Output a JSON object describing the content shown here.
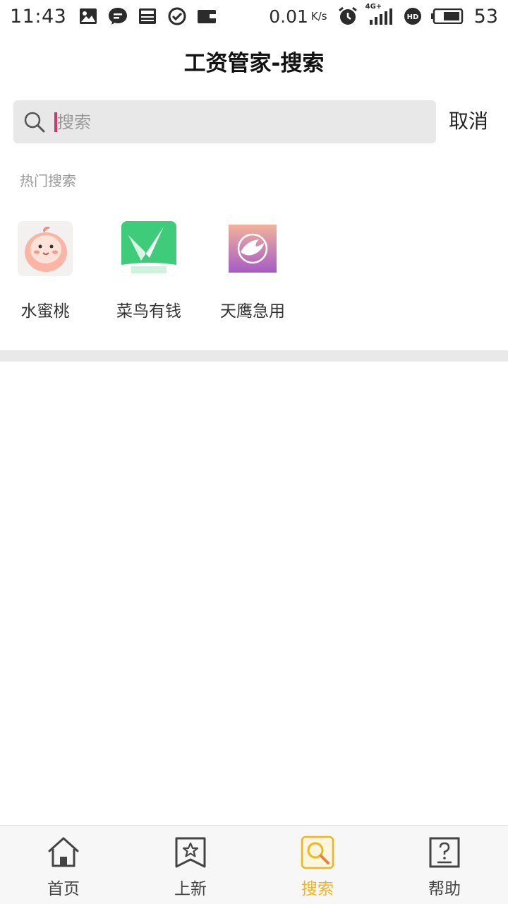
{
  "status_bar": {
    "time": "11:43",
    "net_speed": "0.01",
    "net_unit": "K/s",
    "network": "4G+",
    "battery": "53",
    "icons": [
      "image-icon",
      "chat-icon",
      "news-icon",
      "check-icon",
      "wallet-icon",
      "alarm-icon",
      "signal-icon",
      "hd-icon",
      "battery-icon"
    ]
  },
  "header": {
    "title": "工资管家-搜索"
  },
  "search": {
    "placeholder": "搜索",
    "value": "",
    "cancel_label": "取消"
  },
  "hot_search": {
    "title": "热门搜索",
    "items": [
      {
        "name": "水蜜桃",
        "icon": "peach-app-icon",
        "color": "#f7a48f"
      },
      {
        "name": "菜鸟有钱",
        "icon": "cainiao-app-icon",
        "color": "#3ecb7a"
      },
      {
        "name": "天鹰急用",
        "icon": "eagle-app-icon",
        "color": "#b167c4"
      }
    ]
  },
  "bottom_nav": {
    "active_color": "#f2b51f",
    "items": [
      {
        "label": "首页",
        "icon": "home-icon",
        "active": false
      },
      {
        "label": "上新",
        "icon": "bookmark-star-icon",
        "active": false
      },
      {
        "label": "搜索",
        "icon": "search-tab-icon",
        "active": true
      },
      {
        "label": "帮助",
        "icon": "help-icon",
        "active": false
      }
    ]
  }
}
